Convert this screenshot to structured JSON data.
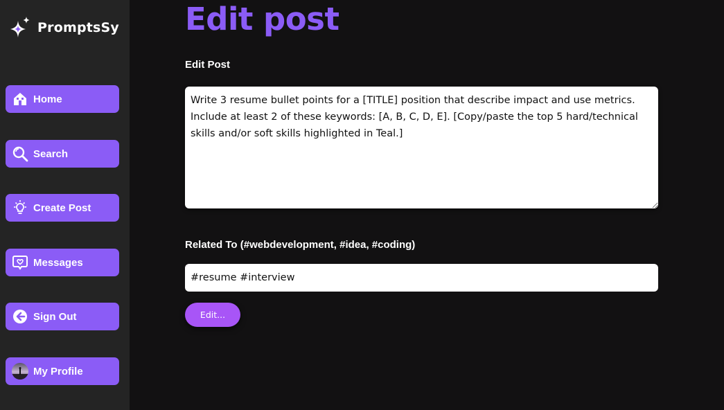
{
  "brand": {
    "name": "PromptsSy"
  },
  "sidebar": {
    "items": [
      {
        "label": "Home",
        "icon": "home-icon"
      },
      {
        "label": "Search",
        "icon": "search-icon"
      },
      {
        "label": "Create Post",
        "icon": "lightbulb-icon"
      },
      {
        "label": "Messages",
        "icon": "message-heart-icon"
      },
      {
        "label": "Sign Out",
        "icon": "sign-out-icon"
      },
      {
        "label": "My Profile",
        "icon": "avatar"
      }
    ]
  },
  "main": {
    "title": "Edit post",
    "post_label": "Edit Post",
    "post_value": "Write 3 resume bullet points for a [TITLE] position that describe impact and use metrics. Include at least 2 of these keywords: [A, B, C, D, E]. [Copy/paste the top 5 hard/technical skills and/or soft skills highlighted in Teal.]",
    "tags_label": "Related To (#webdevelopment, #idea, #coding)",
    "tags_value": "#resume #interview",
    "submit_label": "Edit..."
  },
  "colors": {
    "background": "#121112",
    "sidebar": "#242424",
    "accent": "#8b5cf6",
    "button": "#a855f7"
  }
}
